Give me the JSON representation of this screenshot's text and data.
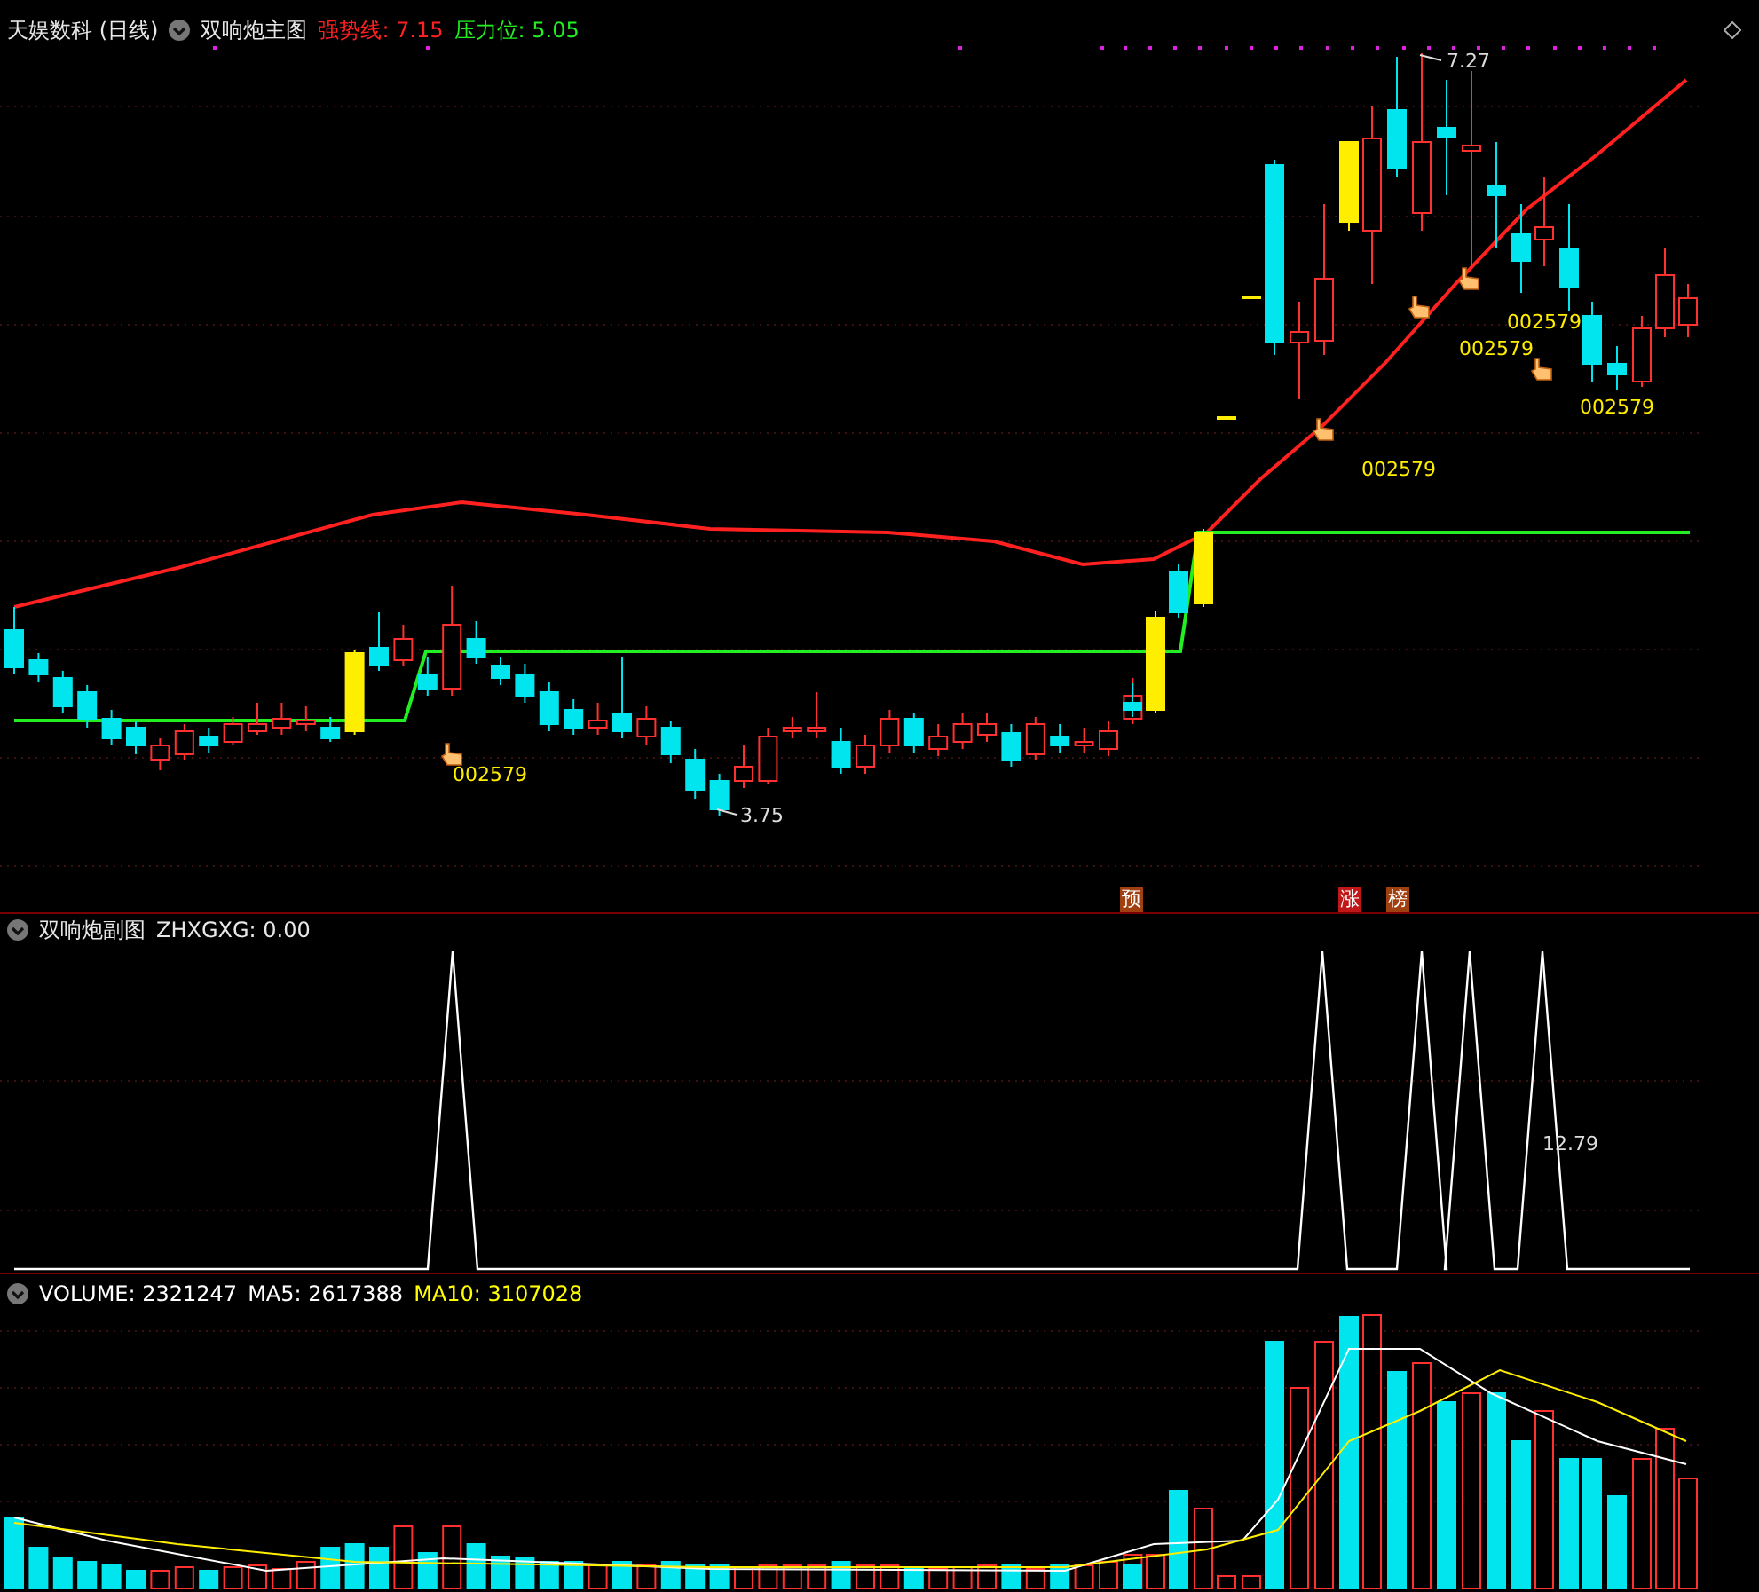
{
  "main": {
    "title": "天娱数科 (日线)",
    "indicator": "双响炮主图",
    "lines": [
      {
        "label": "强势线: 7.15",
        "color": "#ff2020"
      },
      {
        "label": "压力位: 5.05",
        "color": "#22ee22"
      }
    ],
    "high_label": "7.27",
    "low_label": "3.75",
    "signals": [
      "002579",
      "002579",
      "002579",
      "002579",
      "002579"
    ],
    "badges": [
      {
        "label": "预",
        "color": "#a04010"
      },
      {
        "label": "涨",
        "color": "#c01818"
      },
      {
        "label": "榜",
        "color": "#a04010"
      }
    ]
  },
  "sub": {
    "title": "双响炮副图",
    "reading": "ZHXGXG: 0.00",
    "peak_label": "12.79"
  },
  "volume": {
    "readings": [
      {
        "label": "VOLUME: 2321247",
        "color": "#ffffff"
      },
      {
        "label": "MA5: 2617388",
        "color": "#ffffff"
      },
      {
        "label": "MA10: 3107028",
        "color": "#ffff00"
      }
    ]
  }
}
